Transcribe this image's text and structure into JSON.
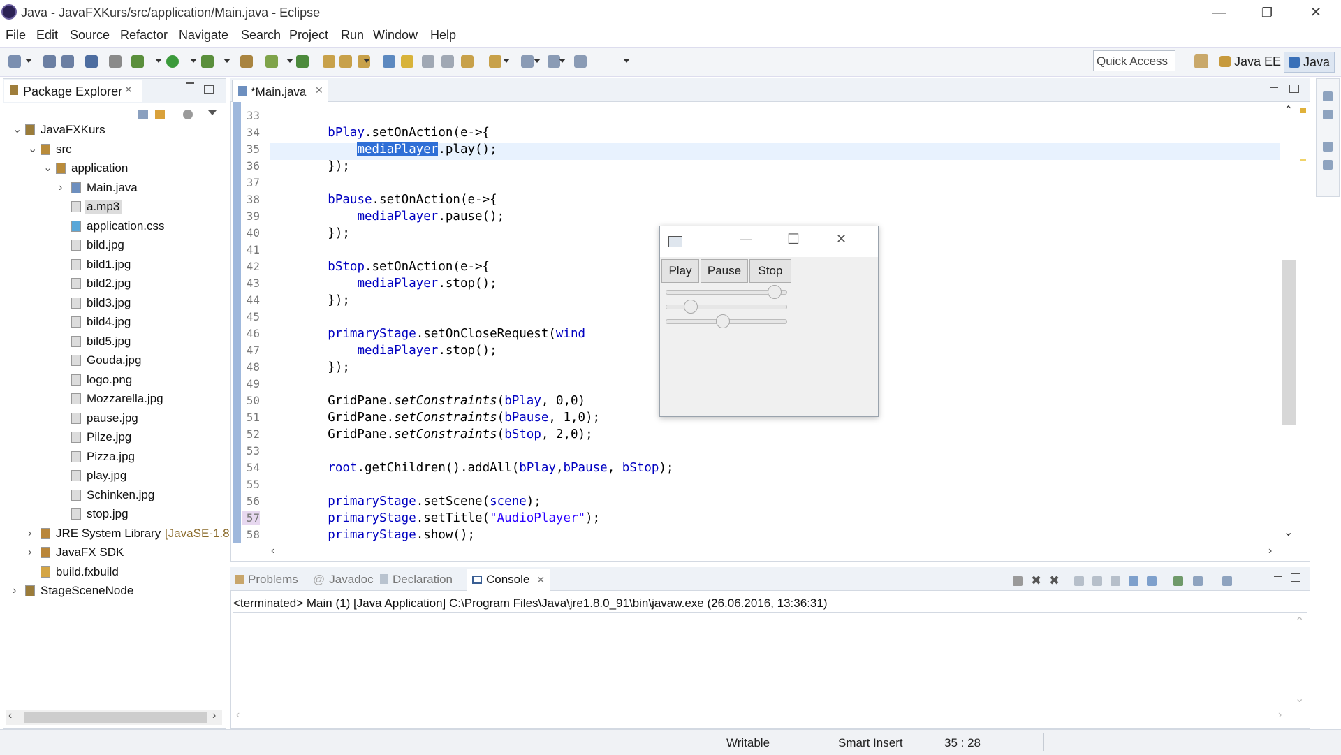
{
  "window": {
    "title": "Java - JavaFXKurs/src/application/Main.java - Eclipse",
    "controls": {
      "minimize": "—",
      "restore": "❐",
      "close": "✕"
    }
  },
  "menu": [
    "File",
    "Edit",
    "Source",
    "Refactor",
    "Navigate",
    "Search",
    "Project",
    "Run",
    "Window",
    "Help"
  ],
  "toolbar": {
    "quick_access": "Quick Access",
    "perspectives": [
      "Java EE",
      "Java"
    ]
  },
  "package_explorer": {
    "tab_label": "Package Explorer",
    "tree": [
      {
        "label": "JavaFXKurs",
        "depth": 0,
        "kind": "project",
        "arrow": "⌄"
      },
      {
        "label": "src",
        "depth": 1,
        "kind": "srcfolder",
        "arrow": "⌄"
      },
      {
        "label": "application",
        "depth": 2,
        "kind": "package",
        "arrow": "⌄"
      },
      {
        "label": "Main.java",
        "depth": 3,
        "kind": "java",
        "arrow": "›"
      },
      {
        "label": "a.mp3",
        "depth": 3,
        "kind": "file",
        "arrow": "",
        "selected": true
      },
      {
        "label": "application.css",
        "depth": 3,
        "kind": "css",
        "arrow": ""
      },
      {
        "label": "bild.jpg",
        "depth": 3,
        "kind": "file",
        "arrow": ""
      },
      {
        "label": "bild1.jpg",
        "depth": 3,
        "kind": "file",
        "arrow": ""
      },
      {
        "label": "bild2.jpg",
        "depth": 3,
        "kind": "file",
        "arrow": ""
      },
      {
        "label": "bild3.jpg",
        "depth": 3,
        "kind": "file",
        "arrow": ""
      },
      {
        "label": "bild4.jpg",
        "depth": 3,
        "kind": "file",
        "arrow": ""
      },
      {
        "label": "bild5.jpg",
        "depth": 3,
        "kind": "file",
        "arrow": ""
      },
      {
        "label": "Gouda.jpg",
        "depth": 3,
        "kind": "file",
        "arrow": ""
      },
      {
        "label": "logo.png",
        "depth": 3,
        "kind": "file",
        "arrow": ""
      },
      {
        "label": "Mozzarella.jpg",
        "depth": 3,
        "kind": "file",
        "arrow": ""
      },
      {
        "label": "pause.jpg",
        "depth": 3,
        "kind": "file",
        "arrow": ""
      },
      {
        "label": "Pilze.jpg",
        "depth": 3,
        "kind": "file",
        "arrow": ""
      },
      {
        "label": "Pizza.jpg",
        "depth": 3,
        "kind": "file",
        "arrow": ""
      },
      {
        "label": "play.jpg",
        "depth": 3,
        "kind": "file",
        "arrow": ""
      },
      {
        "label": "Schinken.jpg",
        "depth": 3,
        "kind": "file",
        "arrow": ""
      },
      {
        "label": "stop.jpg",
        "depth": 3,
        "kind": "file",
        "arrow": ""
      },
      {
        "label": "JRE System Library",
        "suffix": "[JavaSE-1.8",
        "depth": 1,
        "kind": "library",
        "arrow": "›"
      },
      {
        "label": "JavaFX SDK",
        "depth": 1,
        "kind": "library",
        "arrow": "›"
      },
      {
        "label": "build.fxbuild",
        "depth": 1,
        "kind": "fxbuild",
        "arrow": ""
      },
      {
        "label": "StageSceneNode",
        "depth": 0,
        "kind": "project",
        "arrow": "›"
      }
    ]
  },
  "editor": {
    "tab_label": "*Main.java",
    "lines": [
      {
        "n": "33",
        "code": []
      },
      {
        "n": "34",
        "code": [
          [
            "        ",
            ""
          ],
          [
            "bPlay",
            "fld"
          ],
          [
            ".setOnAction(e->{",
            ""
          ]
        ]
      },
      {
        "n": "35",
        "code": [
          [
            "            ",
            ""
          ],
          [
            "mediaPlayer",
            "hl"
          ],
          [
            ".play();",
            ""
          ]
        ]
      },
      {
        "n": "36",
        "code": [
          [
            "        });",
            ""
          ]
        ]
      },
      {
        "n": "37",
        "code": []
      },
      {
        "n": "38",
        "code": [
          [
            "        ",
            ""
          ],
          [
            "bPause",
            "fld"
          ],
          [
            ".setOnAction(e->{",
            ""
          ]
        ]
      },
      {
        "n": "39",
        "code": [
          [
            "            ",
            ""
          ],
          [
            "mediaPlayer",
            "fld"
          ],
          [
            ".pause();",
            ""
          ]
        ]
      },
      {
        "n": "40",
        "code": [
          [
            "        });",
            ""
          ]
        ]
      },
      {
        "n": "41",
        "code": []
      },
      {
        "n": "42",
        "code": [
          [
            "        ",
            ""
          ],
          [
            "bStop",
            "fld"
          ],
          [
            ".setOnAction(e->{",
            ""
          ]
        ]
      },
      {
        "n": "43",
        "code": [
          [
            "            ",
            ""
          ],
          [
            "mediaPlayer",
            "fld"
          ],
          [
            ".stop();",
            ""
          ]
        ]
      },
      {
        "n": "44",
        "code": [
          [
            "        });",
            ""
          ]
        ]
      },
      {
        "n": "45",
        "code": []
      },
      {
        "n": "46",
        "code": [
          [
            "        ",
            ""
          ],
          [
            "primaryStage",
            "fld"
          ],
          [
            ".setOnCloseRequest(",
            ""
          ],
          [
            "wind",
            "fld"
          ]
        ]
      },
      {
        "n": "47",
        "code": [
          [
            "            ",
            ""
          ],
          [
            "mediaPlayer",
            "fld"
          ],
          [
            ".stop();",
            ""
          ]
        ]
      },
      {
        "n": "48",
        "code": [
          [
            "        });",
            ""
          ]
        ]
      },
      {
        "n": "49",
        "code": []
      },
      {
        "n": "50",
        "code": [
          [
            "        GridPane.",
            ""
          ],
          [
            "setConstraints",
            "ital"
          ],
          [
            "(",
            ""
          ],
          [
            "bPlay",
            "fld"
          ],
          [
            ", 0,0)",
            ""
          ]
        ]
      },
      {
        "n": "51",
        "code": [
          [
            "        GridPane.",
            ""
          ],
          [
            "setConstraints",
            "ital"
          ],
          [
            "(",
            ""
          ],
          [
            "bPause",
            "fld"
          ],
          [
            ", 1,0);",
            ""
          ]
        ]
      },
      {
        "n": "52",
        "code": [
          [
            "        GridPane.",
            ""
          ],
          [
            "setConstraints",
            "ital"
          ],
          [
            "(",
            ""
          ],
          [
            "bStop",
            "fld"
          ],
          [
            ", 2,0);",
            ""
          ]
        ]
      },
      {
        "n": "53",
        "code": []
      },
      {
        "n": "54",
        "code": [
          [
            "        ",
            ""
          ],
          [
            "root",
            "fld"
          ],
          [
            ".getChildren().addAll(",
            ""
          ],
          [
            "bPlay",
            "fld"
          ],
          [
            ",",
            ""
          ],
          [
            "bPause",
            "fld"
          ],
          [
            ", ",
            ""
          ],
          [
            "bStop",
            "fld"
          ],
          [
            ");",
            ""
          ]
        ]
      },
      {
        "n": "55",
        "code": []
      },
      {
        "n": "56",
        "code": [
          [
            "        ",
            ""
          ],
          [
            "primaryStage",
            "fld"
          ],
          [
            ".setScene(",
            ""
          ],
          [
            "scene",
            "fld"
          ],
          [
            ");",
            ""
          ]
        ]
      },
      {
        "n": "57",
        "code": [
          [
            "        ",
            ""
          ],
          [
            "primaryStage",
            "fld"
          ],
          [
            ".setTitle(",
            ""
          ],
          [
            "\"AudioPlayer\"",
            "str"
          ],
          [
            ");",
            ""
          ]
        ]
      },
      {
        "n": "58",
        "code": [
          [
            "        ",
            ""
          ],
          [
            "primaryStage",
            "fld"
          ],
          [
            ".show();",
            ""
          ]
        ]
      }
    ]
  },
  "popup": {
    "controls": {
      "minimize": "—",
      "maximize": "☐",
      "close": "✕"
    },
    "buttons": [
      "Play",
      "Pause",
      "Stop"
    ],
    "sliders": [
      {
        "name": "progress",
        "value": 0.95
      },
      {
        "name": "second",
        "value": 0.17
      },
      {
        "name": "third",
        "value": 0.47
      }
    ]
  },
  "console": {
    "tabs": [
      "Problems",
      "Javadoc",
      "Declaration",
      "Console"
    ],
    "active_tab": "Console",
    "output": "<terminated> Main (1) [Java Application] C:\\Program Files\\Java\\jre1.8.0_91\\bin\\javaw.exe (26.06.2016, 13:36:31)"
  },
  "status": {
    "mode": "Writable",
    "insert": "Smart Insert",
    "position": "35 : 28"
  },
  "colors": {
    "accent": "#2f6fd6",
    "field": "#0000c0",
    "string": "#2a00ff"
  }
}
